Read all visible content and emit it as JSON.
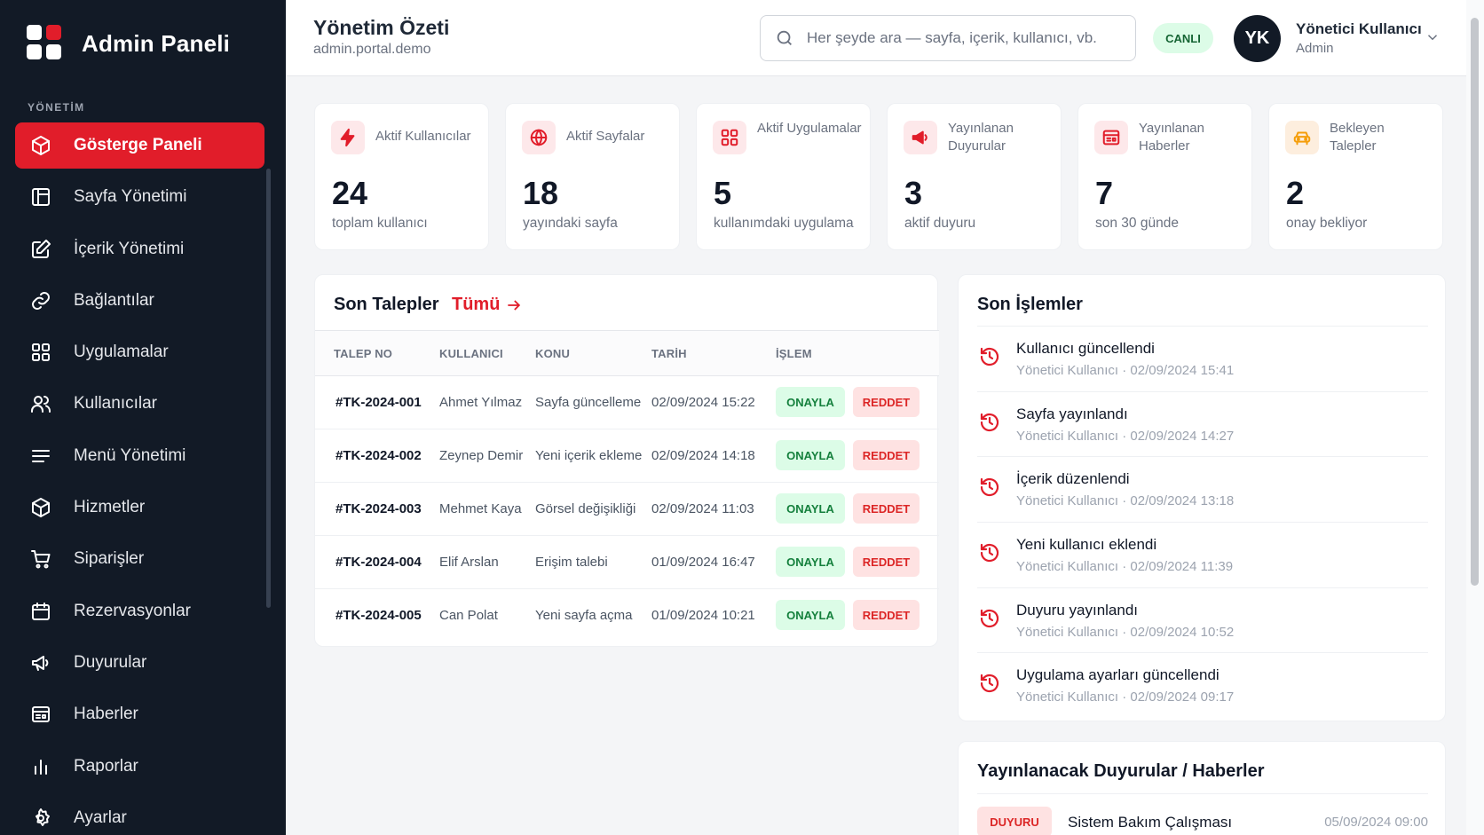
{
  "sidebar": {
    "brand": "Admin Paneli",
    "section_label": "YÖNETİM",
    "items": [
      {
        "label": "Gösterge Paneli",
        "icon": "dashboard-icon"
      },
      {
        "label": "Sayfa Yönetimi",
        "icon": "page-icon"
      },
      {
        "label": "İçerik Yönetimi",
        "icon": "edit-icon"
      },
      {
        "label": "Bağlantılar",
        "icon": "link-icon"
      },
      {
        "label": "Uygulamalar",
        "icon": "apps-icon"
      },
      {
        "label": "Kullanıcılar",
        "icon": "users-icon"
      },
      {
        "label": "Menü Yönetimi",
        "icon": "menu-icon"
      },
      {
        "label": "Hizmetler",
        "icon": "box-icon"
      },
      {
        "label": "Siparişler",
        "icon": "cart-icon"
      },
      {
        "label": "Rezervasyonlar",
        "icon": "calendar-icon"
      },
      {
        "label": "Duyurular",
        "icon": "megaphone-icon"
      },
      {
        "label": "Haberler",
        "icon": "news-icon"
      },
      {
        "label": "Raporlar",
        "icon": "bar-chart-icon"
      },
      {
        "label": "Ayarlar",
        "icon": "gear-icon"
      }
    ],
    "active_index": 0
  },
  "header": {
    "title": "Yönetim Özeti",
    "subtitle": "admin.portal.demo",
    "search_placeholder": "Her şeyde ara — sayfa, içerik, kullanıcı, vb.",
    "live_badge": "CANLI",
    "avatar_initials": "YK",
    "user_name": "Yönetici Kullanıcı",
    "user_role": "Admin"
  },
  "stats": [
    {
      "label": "Aktif Kullanıcılar",
      "value": "24",
      "sub": "toplam kullanıcı",
      "icon": "bolt-icon"
    },
    {
      "label": "Aktif Sayfalar",
      "value": "18",
      "sub": "yayındaki sayfa",
      "icon": "globe-icon"
    },
    {
      "label": "Aktif Uygulamalar",
      "value": "5",
      "sub": "kullanımdaki uygulama",
      "icon": "apps-icon"
    },
    {
      "label": "Yayınlanan Duyurular",
      "value": "3",
      "sub": "aktif duyuru",
      "icon": "megaphone-icon"
    },
    {
      "label": "Yayınlanan Haberler",
      "value": "7",
      "sub": "son 30 günde",
      "icon": "news-icon"
    },
    {
      "label": "Bekleyen Talepler",
      "value": "2",
      "sub": "onay bekliyor",
      "icon": "car-icon"
    }
  ],
  "requests": {
    "title": "Son Talepler",
    "all_link": "Tümü",
    "columns": [
      "TALEP NO",
      "KULLANICI",
      "KONU",
      "TARİH",
      "İŞLEM"
    ],
    "approve_label": "ONAYLA",
    "reject_label": "REDDET",
    "rows": [
      {
        "no": "#TK-2024-001",
        "user": "Ahmet Yılmaz",
        "subject": "Sayfa güncelleme",
        "date": "02/09/2024 15:22"
      },
      {
        "no": "#TK-2024-002",
        "user": "Zeynep Demir",
        "subject": "Yeni içerik ekleme",
        "date": "02/09/2024 14:18"
      },
      {
        "no": "#TK-2024-003",
        "user": "Mehmet Kaya",
        "subject": "Görsel değişikliği",
        "date": "02/09/2024 11:03"
      },
      {
        "no": "#TK-2024-004",
        "user": "Elif Arslan",
        "subject": "Erişim talebi",
        "date": "01/09/2024 16:47"
      },
      {
        "no": "#TK-2024-005",
        "user": "Can Polat",
        "subject": "Yeni sayfa açma",
        "date": "01/09/2024 10:21"
      }
    ]
  },
  "activity": {
    "title": "Son İşlemler",
    "items": [
      {
        "title": "Kullanıcı güncellendi",
        "meta": "Yönetici Kullanıcı · 02/09/2024 15:41"
      },
      {
        "title": "Sayfa yayınlandı",
        "meta": "Yönetici Kullanıcı · 02/09/2024 14:27"
      },
      {
        "title": "İçerik düzenlendi",
        "meta": "Yönetici Kullanıcı · 02/09/2024 13:18"
      },
      {
        "title": "Yeni kullanıcı eklendi",
        "meta": "Yönetici Kullanıcı · 02/09/2024 11:39"
      },
      {
        "title": "Duyuru yayınlandı",
        "meta": "Yönetici Kullanıcı · 02/09/2024 10:52"
      },
      {
        "title": "Uygulama ayarları güncellendi",
        "meta": "Yönetici Kullanıcı · 02/09/2024 09:17"
      }
    ]
  },
  "upcoming": {
    "title": "Yayınlanacak Duyurular / Haberler",
    "items": [
      {
        "badge": "DUYURU",
        "title": "Sistem Bakım Çalışması",
        "date": "05/09/2024 09:00"
      }
    ]
  },
  "colors": {
    "accent": "#e11d2a",
    "sidebar_bg": "#121a26",
    "success": "#15803d",
    "warning": "#f59e0b"
  }
}
